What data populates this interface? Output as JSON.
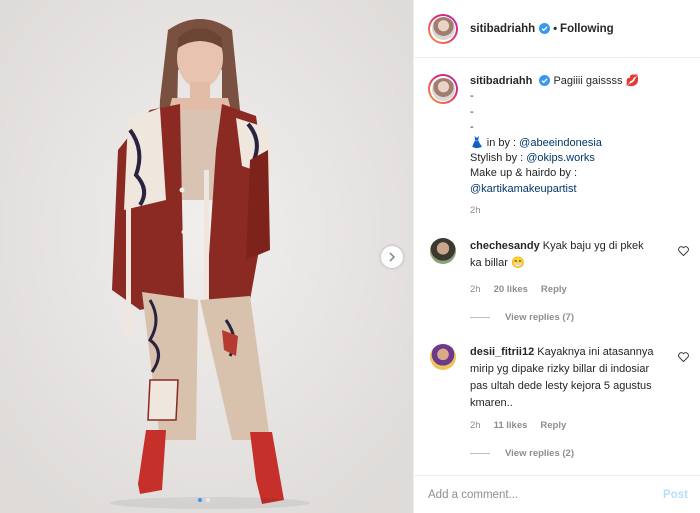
{
  "media": {
    "carousel_dots": 2,
    "active_dot": 0,
    "next_icon": "chevron-right-icon"
  },
  "header": {
    "username": "sitibadriahh",
    "verified_icon": "verified-badge-icon",
    "separator": "•",
    "follow_state": "Following"
  },
  "caption": {
    "username": "sitibadriahh",
    "text": "Pagiiii gaissss",
    "lips_emoji": "💋",
    "dash_lines": [
      "-",
      "-",
      "-"
    ],
    "dress_emoji": "👗",
    "in_by_label": "in by : ",
    "in_by_mention": "@abeeindonesia",
    "stylish_label": "Stylish by : ",
    "stylish_mention": "@okips.works",
    "makeup_label": "Make up & hairdo by :",
    "makeup_mention": "@kartikamakeupartist",
    "time": "2h"
  },
  "comments": [
    {
      "username": "chechesandy",
      "text": "Kyak baju yg di pkek ka billar",
      "emoji": "😁",
      "time": "2h",
      "likes": "20 likes",
      "reply": "Reply",
      "view_replies": "View replies (7)"
    },
    {
      "username": "desii_fitrii12",
      "text": "Kayaknya ini atasannya mirip yg dipake rizky billar di indosiar pas ultah dede lesty kejora 5 agustus kmaren..",
      "time": "2h",
      "likes": "11 likes",
      "reply": "Reply",
      "view_replies": "View replies (2)"
    }
  ],
  "composer": {
    "placeholder": "Add a comment...",
    "post_label": "Post"
  },
  "colors": {
    "link": "#00376b",
    "muted": "#8e8e8e",
    "verified": "#3897f0",
    "post_disabled": "#b2dffc"
  }
}
